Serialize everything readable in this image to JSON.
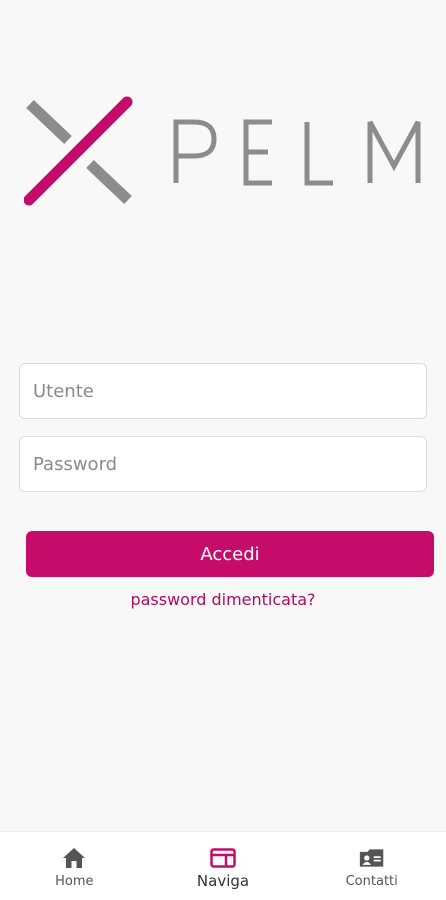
{
  "logo": {
    "text": "PELM",
    "accent_color": "#c60c6b",
    "gray_color": "#8c8c8c"
  },
  "form": {
    "username_placeholder": "Utente",
    "password_placeholder": "Password",
    "login_label": "Accedi",
    "forgot_label": "password dimenticata?"
  },
  "colors": {
    "accent": "#c60c6b",
    "link": "#b10a5f",
    "background": "#f8f8f8"
  },
  "bottom_nav": {
    "active": "Naviga",
    "items": [
      {
        "label": "Home",
        "icon": "home-icon"
      },
      {
        "label": "Naviga",
        "icon": "browser-window-icon"
      },
      {
        "label": "Contatti",
        "icon": "contact-card-icon"
      }
    ]
  }
}
